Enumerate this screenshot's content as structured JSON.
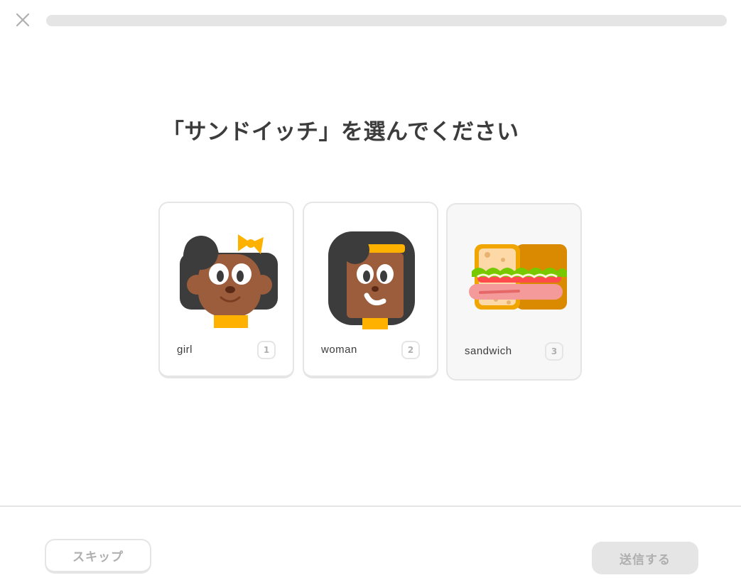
{
  "header": {
    "close_icon": "close-icon",
    "progress_fraction": 0.0
  },
  "prompt": "「サンドイッチ」を選んでください",
  "choices": [
    {
      "label": "girl",
      "key": "1",
      "image": "girl-illustration"
    },
    {
      "label": "woman",
      "key": "2",
      "image": "woman-illustration"
    },
    {
      "label": "sandwich",
      "key": "3",
      "image": "sandwich-illustration"
    }
  ],
  "footer": {
    "skip_label": "スキップ",
    "submit_label": "送信する"
  },
  "colors": {
    "border": "#e5e5e5",
    "disabled_text": "#afafaf",
    "text": "#3c3c3c",
    "skin": "#9b5d3b",
    "hair": "#3c3c3c",
    "accent_yellow": "#ffb100"
  }
}
